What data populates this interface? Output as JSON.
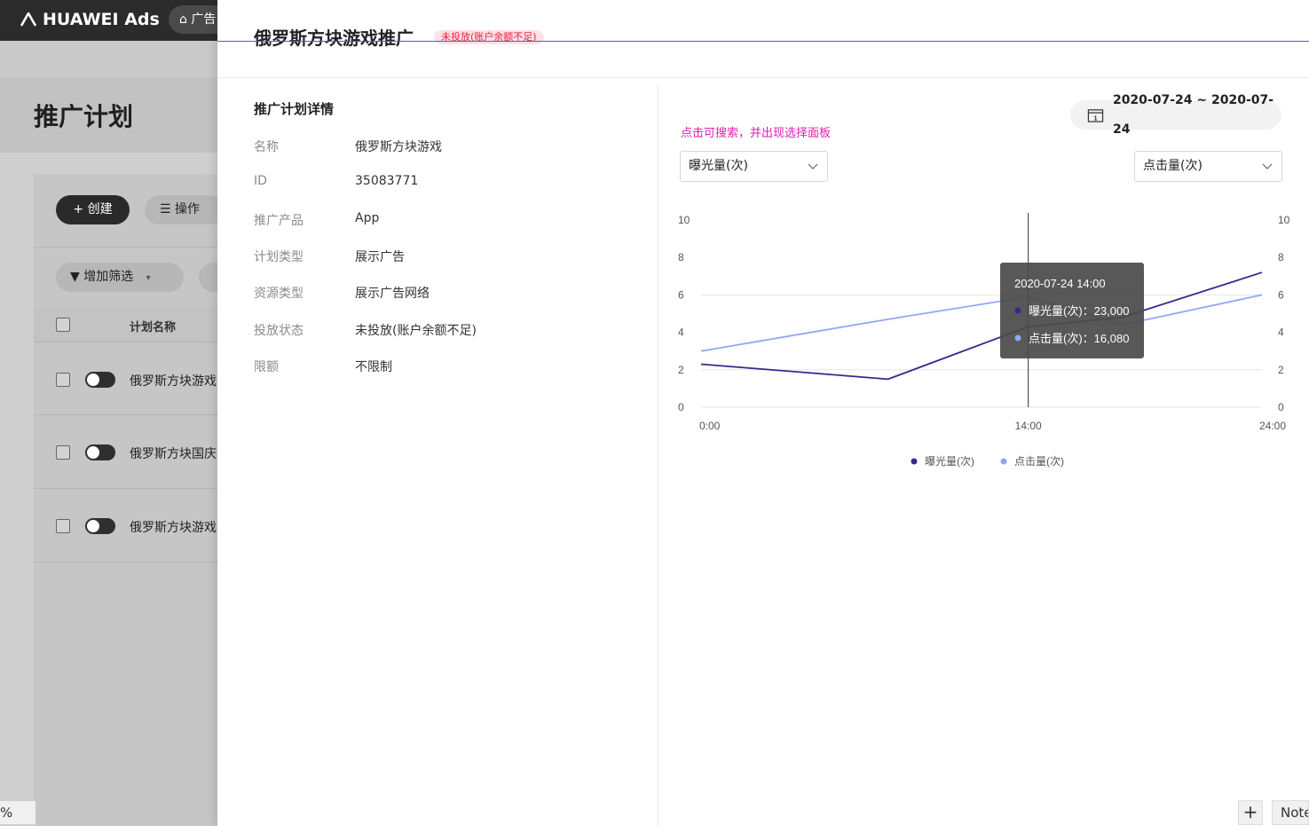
{
  "app": {
    "brand": "HUAWEI Ads",
    "nav_pill": "广告",
    "page_title": "推广计划",
    "create_label": "创建",
    "ops_label": "操作",
    "filter_label": "增加筛选",
    "col_name_header": "计划名称",
    "rows": [
      {
        "name": "俄罗斯方块游戏"
      },
      {
        "name": "俄罗斯方块国庆"
      },
      {
        "name": "俄罗斯方块游戏"
      }
    ],
    "zoom_text": "%",
    "zoom_plus": "+"
  },
  "drawer": {
    "title": "俄罗斯方块游戏推广",
    "status_tag": "未投放(账户余额不足)",
    "section_title": "推广计划详情",
    "details": [
      {
        "label": "名称",
        "value": "俄罗斯方块游戏"
      },
      {
        "label": "ID",
        "value": "35083771"
      },
      {
        "label": "推广产品",
        "value": "App"
      },
      {
        "label": "计划类型",
        "value": "展示广告"
      },
      {
        "label": "资源类型",
        "value": "展示广告网络"
      },
      {
        "label": "投放状态",
        "value": "未投放(账户余额不足)"
      },
      {
        "label": "限额",
        "value": "不限制"
      }
    ],
    "hint": "点击可搜索，并出现选择面板",
    "date_range": "2020-07-24 ~ 2020-07-24",
    "left_metric": "曝光量(次)",
    "right_metric": "点击量(次)",
    "note_plus": "+",
    "note_label": "Note"
  },
  "colors": {
    "series_dark": "#3b2590",
    "series_light": "#8ea8f5",
    "status_red": "#e5233a",
    "hint_magenta": "#e01fb0"
  },
  "chart_data": {
    "type": "line",
    "x": [
      "0:00",
      "8:00",
      "14:00",
      "18:00",
      "24:00"
    ],
    "x_ticks": [
      "0:00",
      "14:00",
      "24:00"
    ],
    "y_ticks_left": [
      0,
      2,
      4,
      6,
      8,
      10
    ],
    "y_ticks_right": [
      0,
      2,
      4,
      6,
      8,
      10
    ],
    "ylim": [
      0,
      10
    ],
    "series": [
      {
        "name": "曝光量(次)",
        "color": "#3b2590",
        "values": [
          2.3,
          1.5,
          4.3,
          4.8,
          7.2
        ]
      },
      {
        "name": "点击量(次)",
        "color": "#8ea8f5",
        "values": [
          3.0,
          4.7,
          5.9,
          4.4,
          6.0
        ]
      }
    ],
    "tooltip": {
      "title": "2020-07-24 14:00",
      "lines": [
        "曝光量(次)：23,000",
        "点击量(次)：16,080"
      ]
    },
    "grid": true,
    "legend": "bottom-center"
  }
}
